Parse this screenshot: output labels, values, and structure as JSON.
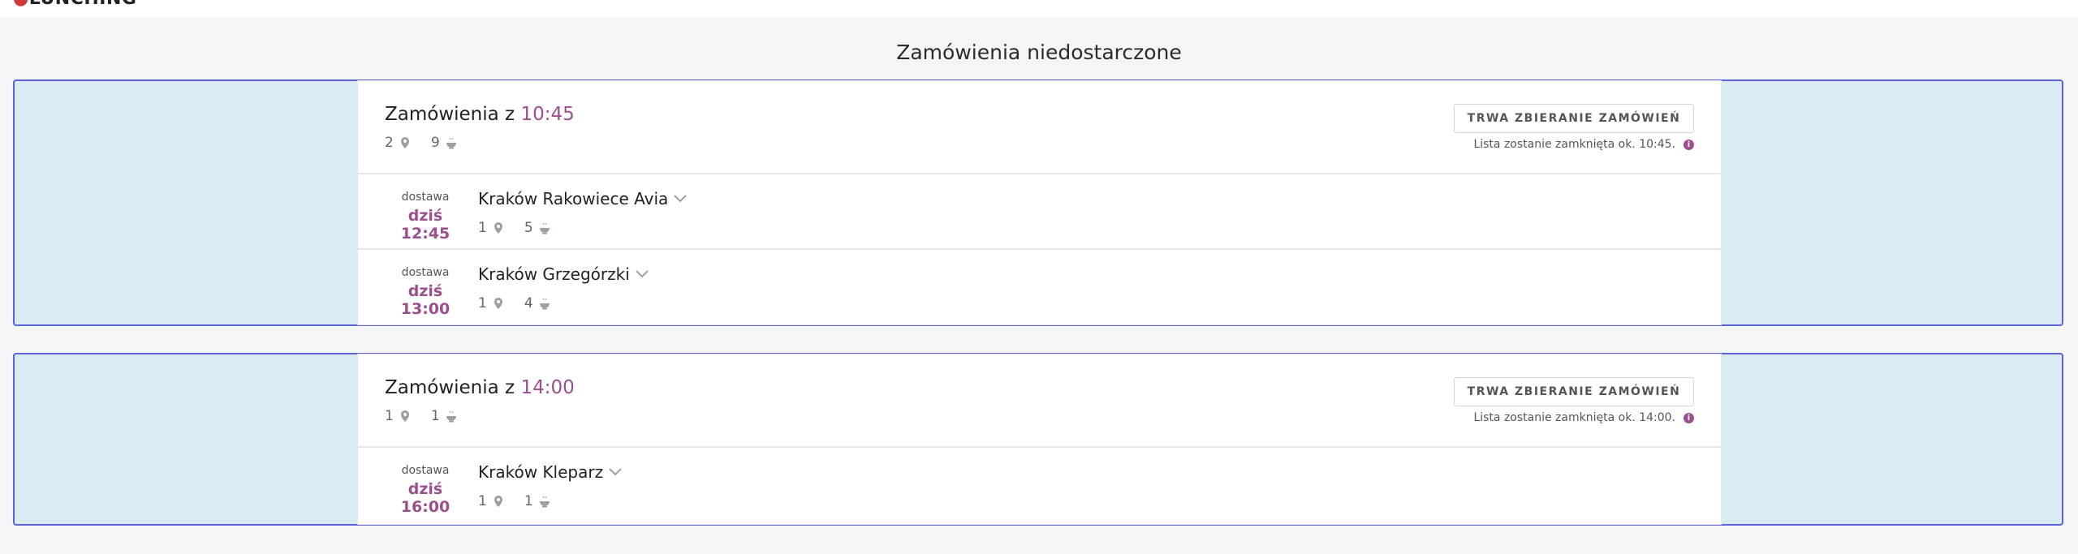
{
  "app": {
    "logo_text": "LUNCHING"
  },
  "page": {
    "title": "Zamówienia niedostarczone"
  },
  "groups": [
    {
      "title_prefix": "Zamówienia z",
      "time": "10:45",
      "locations": "2",
      "meals": "9",
      "status": "TRWA ZBIERANIE ZAMÓWIEŃ",
      "note": "Lista zostanie zamknięta ok. 10:45.",
      "deliveries": [
        {
          "label": "dostawa",
          "when": "dziś 12:45",
          "location": "Kraków Rakowiece Avia",
          "locations": "1",
          "meals": "5"
        },
        {
          "label": "dostawa",
          "when": "dziś 13:00",
          "location": "Kraków Grzegórzki",
          "locations": "1",
          "meals": "4"
        }
      ]
    },
    {
      "title_prefix": "Zamówienia z",
      "time": "14:00",
      "locations": "1",
      "meals": "1",
      "status": "TRWA ZBIERANIE ZAMÓWIEŃ",
      "note": "Lista zostanie zamknięta ok. 14:00.",
      "deliveries": [
        {
          "label": "dostawa",
          "when": "dziś 16:00",
          "location": "Kraków Kleparz",
          "locations": "1",
          "meals": "1"
        }
      ]
    }
  ],
  "colors": {
    "accent": "#9b4f8e",
    "group_border": "#5c63d8",
    "group_bg": "#dbebf3"
  },
  "icons": {
    "location": "map-pin-icon",
    "meal": "meal-bowl-icon",
    "expand": "chevron-down-icon",
    "info": "info-icon"
  }
}
